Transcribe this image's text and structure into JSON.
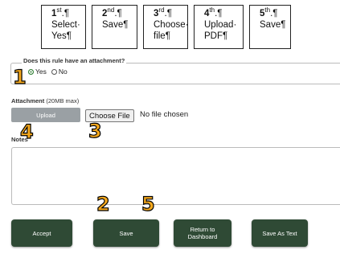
{
  "steps": [
    {
      "ord": "1",
      "sup": "st",
      "mark": ".¶",
      "lines": [
        "Select·",
        "Yes¶"
      ]
    },
    {
      "ord": "2",
      "sup": "nd",
      "mark": ".¶",
      "lines": [
        "Save¶"
      ]
    },
    {
      "ord": "3",
      "sup": "rd",
      "mark": ".¶",
      "lines": [
        "Choose·",
        "file¶"
      ]
    },
    {
      "ord": "4",
      "sup": "th",
      "mark": ".¶",
      "lines": [
        "Upload·",
        "PDF¶"
      ]
    },
    {
      "ord": "5",
      "sup": "th",
      "mark": ".¶",
      "lines": [
        "Save¶"
      ]
    }
  ],
  "attachment_question": {
    "legend": "Does this rule have an attachment?",
    "options": [
      {
        "label": "Yes",
        "selected": true
      },
      {
        "label": "No",
        "selected": false
      }
    ]
  },
  "attachment": {
    "label": "Attachment",
    "limit": "(20MB max)",
    "upload_label": "Upload",
    "choose_label": "Choose File",
    "no_file_text": "No file chosen"
  },
  "notes": {
    "label": "Notes",
    "value": ""
  },
  "actions": {
    "accept_label": "Accept",
    "save_label": "Save",
    "return_label_line1": "Return to",
    "return_label_line2": "Dashboard",
    "save_text_label": "Save As Text"
  },
  "callouts": [
    "1",
    "2",
    "3",
    "4",
    "5"
  ],
  "colors": {
    "action_button": "#2f4a35",
    "upload_button": "#9aa0a4",
    "callout": "#f4a81d",
    "radio_selected": "#2e7d32"
  }
}
